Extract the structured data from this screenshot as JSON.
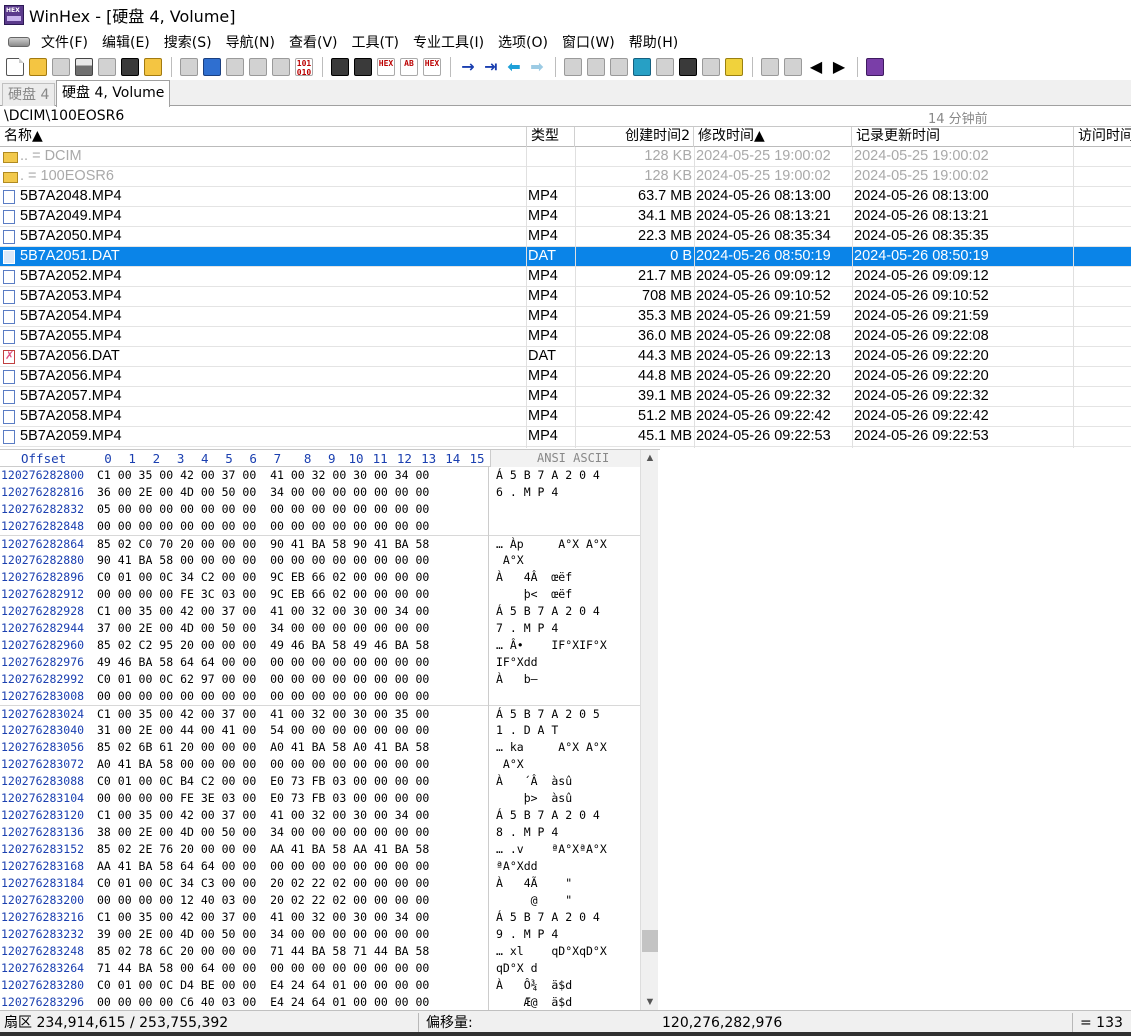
{
  "window": {
    "title": "WinHex - [硬盘 4, Volume]"
  },
  "menu": [
    "文件(F)",
    "编辑(E)",
    "搜索(S)",
    "导航(N)",
    "查看(V)",
    "工具(T)",
    "专业工具(I)",
    "选项(O)",
    "窗口(W)",
    "帮助(H)"
  ],
  "toolbar": {
    "icons": [
      "new-file-icon",
      "open-folder-icon",
      "save-icon",
      "print-icon",
      "properties-icon",
      "options-icon",
      "open-disk-icon",
      "undo-icon",
      "copy-icon",
      "cut-icon",
      "paste-icon",
      "write-icon",
      "hex-copy-icon",
      "find-text-icon",
      "find-hex-icon",
      "find-hex-values-icon",
      "replace-text-icon",
      "replace-hex-icon",
      "goto-offset-icon",
      "goto-sector-icon",
      "back-icon",
      "forward-icon",
      "open-disk-edit-icon",
      "disk-clone-icon",
      "ram-icon",
      "calculator-icon",
      "search-disk-icon",
      "snapshot-icon",
      "file-recovery-icon",
      "hash-icon",
      "data-interpreter-icon",
      "table-view-icon",
      "prev-icon",
      "next-icon",
      "help-book-icon"
    ],
    "small_labels": {
      "binary": "101\n010",
      "hex": "HEX",
      "ab": "AB"
    }
  },
  "tabs": [
    {
      "label": "硬盘 4",
      "active": false
    },
    {
      "label": "硬盘 4, Volume",
      "active": true
    }
  ],
  "pathbar": {
    "path": "\\DCIM\\100EOSR6",
    "time": "14 分钟前"
  },
  "filelist": {
    "columns": {
      "name": "名称▲",
      "type": "类型",
      "size": "创建时间2",
      "modified": "修改时间▲",
      "record": "记录更新时间",
      "access": "访问时间"
    },
    "rows": [
      {
        "icon": "folder",
        "name": "..  =   DCIM",
        "type": "",
        "size": "128 KB",
        "modified": "2024-05-25  19:00:02",
        "record": "2024-05-25  19:00:02",
        "dim": true
      },
      {
        "icon": "folder",
        "name": ".   =   100EOSR6",
        "type": "",
        "size": "128 KB",
        "modified": "2024-05-25  19:00:02",
        "record": "2024-05-25  19:00:02",
        "dim": true
      },
      {
        "icon": "file",
        "name": "5B7A2048.MP4",
        "type": "MP4",
        "size": "63.7 MB",
        "modified": "2024-05-26  08:13:00",
        "record": "2024-05-26  08:13:00"
      },
      {
        "icon": "file",
        "name": "5B7A2049.MP4",
        "type": "MP4",
        "size": "34.1 MB",
        "modified": "2024-05-26  08:13:21",
        "record": "2024-05-26  08:13:21"
      },
      {
        "icon": "file",
        "name": "5B7A2050.MP4",
        "type": "MP4",
        "size": "22.3 MB",
        "modified": "2024-05-26  08:35:34",
        "record": "2024-05-26  08:35:35"
      },
      {
        "icon": "file",
        "name": "5B7A2051.DAT",
        "type": "DAT",
        "size": "0 B",
        "modified": "2024-05-26  08:50:19",
        "record": "2024-05-26  08:50:19",
        "selected": true
      },
      {
        "icon": "file",
        "name": "5B7A2052.MP4",
        "type": "MP4",
        "size": "21.7 MB",
        "modified": "2024-05-26  09:09:12",
        "record": "2024-05-26  09:09:12"
      },
      {
        "icon": "file",
        "name": "5B7A2053.MP4",
        "type": "MP4",
        "size": "708 MB",
        "modified": "2024-05-26  09:10:52",
        "record": "2024-05-26  09:10:52"
      },
      {
        "icon": "file",
        "name": "5B7A2054.MP4",
        "type": "MP4",
        "size": "35.3 MB",
        "modified": "2024-05-26  09:21:59",
        "record": "2024-05-26  09:21:59"
      },
      {
        "icon": "file",
        "name": "5B7A2055.MP4",
        "type": "MP4",
        "size": "36.0 MB",
        "modified": "2024-05-26  09:22:08",
        "record": "2024-05-26  09:22:08"
      },
      {
        "icon": "deleted",
        "name": "5B7A2056.DAT",
        "type": "DAT",
        "size": "44.3 MB",
        "modified": "2024-05-26  09:22:13",
        "record": "2024-05-26  09:22:20"
      },
      {
        "icon": "file",
        "name": "5B7A2056.MP4",
        "type": "MP4",
        "size": "44.8 MB",
        "modified": "2024-05-26  09:22:20",
        "record": "2024-05-26  09:22:20"
      },
      {
        "icon": "file",
        "name": "5B7A2057.MP4",
        "type": "MP4",
        "size": "39.1 MB",
        "modified": "2024-05-26  09:22:32",
        "record": "2024-05-26  09:22:32"
      },
      {
        "icon": "file",
        "name": "5B7A2058.MP4",
        "type": "MP4",
        "size": "51.2 MB",
        "modified": "2024-05-26  09:22:42",
        "record": "2024-05-26  09:22:42"
      },
      {
        "icon": "file",
        "name": "5B7A2059.MP4",
        "type": "MP4",
        "size": "45.1 MB",
        "modified": "2024-05-26  09:22:53",
        "record": "2024-05-26  09:22:53"
      }
    ]
  },
  "hexview": {
    "header": {
      "offset": "Offset",
      "columns": [
        "0",
        "1",
        "2",
        "3",
        "4",
        "5",
        "6",
        "7",
        "8",
        "9",
        "10",
        "11",
        "12",
        "13",
        "14",
        "15"
      ],
      "ansi": "ANSI ASCII"
    },
    "rows": [
      {
        "offset": "120276282800",
        "bytes": "C1 00 35 00 42 00 37 00  41 00 32 00 30 00 34 00",
        "ascii": "Á 5 B 7 A 2 0 4"
      },
      {
        "offset": "120276282816",
        "bytes": "36 00 2E 00 4D 00 50 00  34 00 00 00 00 00 00 00",
        "ascii": "6 . M P 4"
      },
      {
        "offset": "120276282832",
        "bytes": "05 00 00 00 00 00 00 00  00 00 00 00 00 00 00 00",
        "ascii": ""
      },
      {
        "offset": "120276282848",
        "bytes": "00 00 00 00 00 00 00 00  00 00 00 00 00 00 00 00",
        "ascii": ""
      },
      {
        "offset": "120276282864",
        "bytes": "85 02 C0 70 20 00 00 00  90 41 BA 58 90 41 BA 58",
        "ascii": "… Àp     A°X A°X",
        "sep": true
      },
      {
        "offset": "120276282880",
        "bytes": "90 41 BA 58 00 00 00 00  00 00 00 00 00 00 00 00",
        "ascii": " A°X"
      },
      {
        "offset": "120276282896",
        "bytes": "C0 01 00 0C 34 C2 00 00  9C EB 66 02 00 00 00 00",
        "ascii": "À   4Â  œëf"
      },
      {
        "offset": "120276282912",
        "bytes": "00 00 00 00 FE 3C 03 00  9C EB 66 02 00 00 00 00",
        "ascii": "    þ<  œëf"
      },
      {
        "offset": "120276282928",
        "bytes": "C1 00 35 00 42 00 37 00  41 00 32 00 30 00 34 00",
        "ascii": "Á 5 B 7 A 2 0 4"
      },
      {
        "offset": "120276282944",
        "bytes": "37 00 2E 00 4D 00 50 00  34 00 00 00 00 00 00 00",
        "ascii": "7 . M P 4"
      },
      {
        "offset": "120276282960",
        "bytes": "85 02 C2 95 20 00 00 00  49 46 BA 58 49 46 BA 58",
        "ascii": "… Â•    IF°XIF°X"
      },
      {
        "offset": "120276282976",
        "bytes": "49 46 BA 58 64 64 00 00  00 00 00 00 00 00 00 00",
        "ascii": "IF°Xdd"
      },
      {
        "offset": "120276282992",
        "bytes": "C0 01 00 0C 62 97 00 00  00 00 00 00 00 00 00 00",
        "ascii": "À   b—"
      },
      {
        "offset": "120276283008",
        "bytes": "00 00 00 00 00 00 00 00  00 00 00 00 00 00 00 00",
        "ascii": ""
      },
      {
        "offset": "120276283024",
        "bytes": "C1 00 35 00 42 00 37 00  41 00 32 00 30 00 35 00",
        "ascii": "Á 5 B 7 A 2 0 5",
        "sep": true
      },
      {
        "offset": "120276283040",
        "bytes": "31 00 2E 00 44 00 41 00  54 00 00 00 00 00 00 00",
        "ascii": "1 . D A T"
      },
      {
        "offset": "120276283056",
        "bytes": "85 02 6B 61 20 00 00 00  A0 41 BA 58 A0 41 BA 58",
        "ascii": "… ka     A°X A°X"
      },
      {
        "offset": "120276283072",
        "bytes": "A0 41 BA 58 00 00 00 00  00 00 00 00 00 00 00 00",
        "ascii": " A°X"
      },
      {
        "offset": "120276283088",
        "bytes": "C0 01 00 0C B4 C2 00 00  E0 73 FB 03 00 00 00 00",
        "ascii": "À   ´Â  àsû"
      },
      {
        "offset": "120276283104",
        "bytes": "00 00 00 00 FE 3E 03 00  E0 73 FB 03 00 00 00 00",
        "ascii": "    þ>  àsû"
      },
      {
        "offset": "120276283120",
        "bytes": "C1 00 35 00 42 00 37 00  41 00 32 00 30 00 34 00",
        "ascii": "Á 5 B 7 A 2 0 4"
      },
      {
        "offset": "120276283136",
        "bytes": "38 00 2E 00 4D 00 50 00  34 00 00 00 00 00 00 00",
        "ascii": "8 . M P 4"
      },
      {
        "offset": "120276283152",
        "bytes": "85 02 2E 76 20 00 00 00  AA 41 BA 58 AA 41 BA 58",
        "ascii": "… .v    ªA°XªA°X"
      },
      {
        "offset": "120276283168",
        "bytes": "AA 41 BA 58 64 64 00 00  00 00 00 00 00 00 00 00",
        "ascii": "ªA°Xdd"
      },
      {
        "offset": "120276283184",
        "bytes": "C0 01 00 0C 34 C3 00 00  20 02 22 02 00 00 00 00",
        "ascii": "À   4Ã    \""
      },
      {
        "offset": "120276283200",
        "bytes": "00 00 00 00 12 40 03 00  20 02 22 02 00 00 00 00",
        "ascii": "     @    \""
      },
      {
        "offset": "120276283216",
        "bytes": "C1 00 35 00 42 00 37 00  41 00 32 00 30 00 34 00",
        "ascii": "Á 5 B 7 A 2 0 4"
      },
      {
        "offset": "120276283232",
        "bytes": "39 00 2E 00 4D 00 50 00  34 00 00 00 00 00 00 00",
        "ascii": "9 . M P 4"
      },
      {
        "offset": "120276283248",
        "bytes": "85 02 78 6C 20 00 00 00  71 44 BA 58 71 44 BA 58",
        "ascii": "… xl    qD°XqD°X"
      },
      {
        "offset": "120276283264",
        "bytes": "71 44 BA 58 00 64 00 00  00 00 00 00 00 00 00 00",
        "ascii": "qD°X d"
      },
      {
        "offset": "120276283280",
        "bytes": "C0 01 00 0C D4 BE 00 00  E4 24 64 01 00 00 00 00",
        "ascii": "À   Ô¾  ä$d"
      },
      {
        "offset": "120276283296",
        "bytes": "00 00 00 00 C6 40 03 00  E4 24 64 01 00 00 00 00",
        "ascii": "    Æ@  ä$d"
      }
    ]
  },
  "statusbar": {
    "sector": "扇区 234,914,615 / 253,755,392",
    "offset_label": "偏移量:",
    "offset_value": "120,276,282,976",
    "equals": "= 133"
  }
}
